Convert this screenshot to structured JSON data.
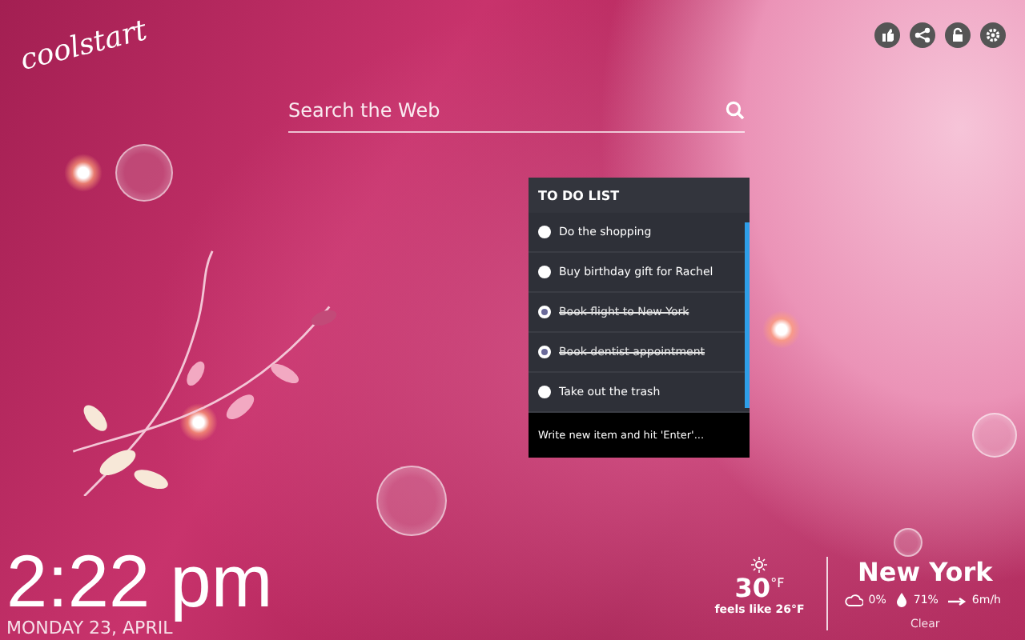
{
  "logo": {
    "text": "coolstart"
  },
  "toolbar": [
    {
      "kind": "like"
    },
    {
      "kind": "share"
    },
    {
      "kind": "lock"
    },
    {
      "kind": "settings"
    }
  ],
  "search": {
    "placeholder": "Search the Web"
  },
  "todo": {
    "title": "TO DO LIST",
    "items": [
      {
        "text": "Do the shopping",
        "done": false
      },
      {
        "text": "Buy birthday gift for Rachel",
        "done": false
      },
      {
        "text": "Book flight to New York",
        "done": true
      },
      {
        "text": "Book dentist appointment",
        "done": true
      },
      {
        "text": "Take out the trash",
        "done": false
      }
    ],
    "new_item": {
      "placeholder": "Write new item and hit 'Enter'..."
    }
  },
  "clock": {
    "time": "2:22 pm",
    "date": "MONDAY 23, APRIL"
  },
  "weather": {
    "temperature": "30",
    "unit": "°F",
    "feels_like": "feels like 26°F",
    "city": "New York",
    "precipitation": "0%",
    "humidity": "71%",
    "wind": "6m/h",
    "condition": "Clear"
  }
}
